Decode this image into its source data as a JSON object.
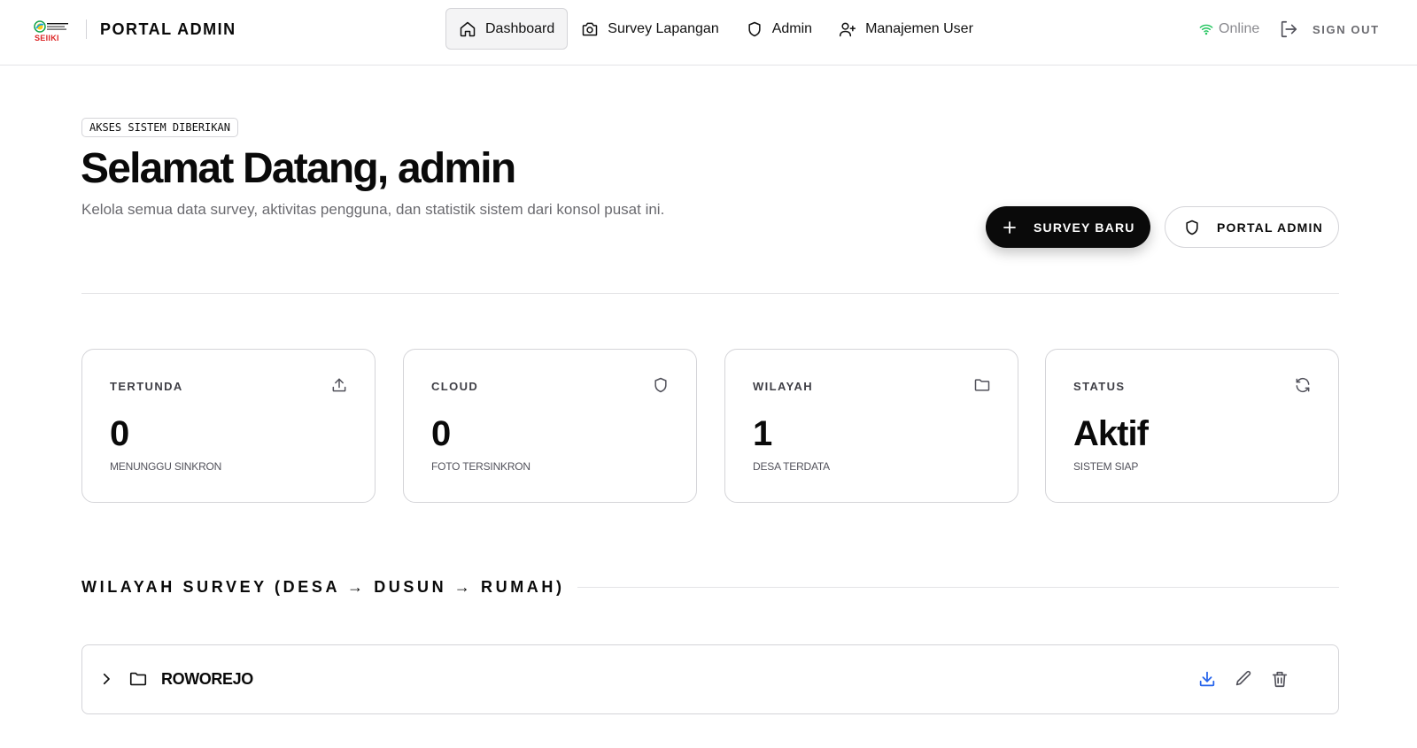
{
  "header": {
    "logo_text": "SEIIKI",
    "brand": "PORTAL ADMIN",
    "nav": [
      {
        "label": "Dashboard",
        "icon": "home-icon",
        "active": true
      },
      {
        "label": "Survey Lapangan",
        "icon": "camera-icon",
        "active": false
      },
      {
        "label": "Admin",
        "icon": "shield-icon",
        "active": false
      },
      {
        "label": "Manajemen User",
        "icon": "user-plus-icon",
        "active": false
      }
    ],
    "status": "Online",
    "status_icon": "wifi-icon",
    "signout_label": "SIGN OUT",
    "signout_icon": "log-out-icon"
  },
  "hero": {
    "badge": "AKSES SISTEM DIBERIKAN",
    "title": "Selamat Datang, admin",
    "subtitle": "Kelola semua data survey, aktivitas pengguna, dan statistik sistem dari konsol pusat ini.",
    "primary_button": "SURVEY BARU",
    "secondary_button": "PORTAL ADMIN"
  },
  "stats": [
    {
      "label": "TERTUNDA",
      "value": "0",
      "caption": "MENUNGGU SINKRON",
      "icon": "upload-icon"
    },
    {
      "label": "CLOUD",
      "value": "0",
      "caption": "FOTO TERSINKRON",
      "icon": "shield-icon"
    },
    {
      "label": "WILAYAH",
      "value": "1",
      "caption": "DESA TERDATA",
      "icon": "folder-icon"
    },
    {
      "label": "STATUS",
      "value": "Aktif",
      "caption": "SISTEM SIAP",
      "icon": "refresh-icon"
    }
  ],
  "section": {
    "title": "WILAYAH SURVEY (DESA → DUSUN → RUMAH)"
  },
  "regions": [
    {
      "name": "ROWOREJO"
    }
  ],
  "colors": {
    "accent": "#0a0a0a",
    "online": "#22c55e",
    "download": "#2563eb",
    "border": "#d4d4d8"
  }
}
